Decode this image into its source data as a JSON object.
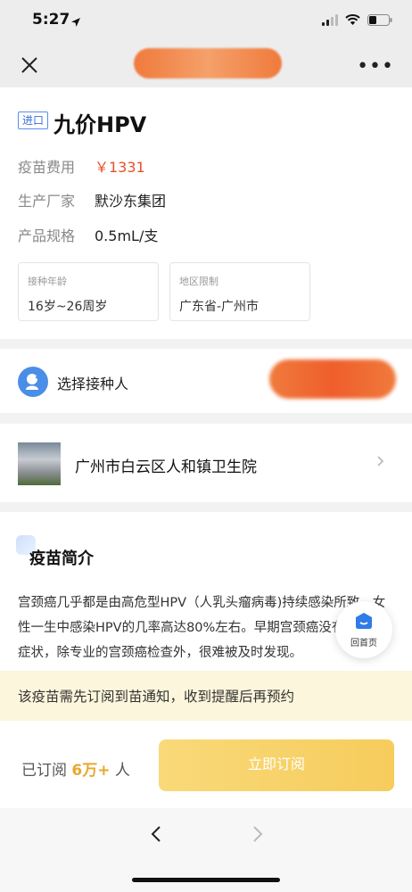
{
  "status_bar": {
    "time": "5:27"
  },
  "vaccine": {
    "import_tag": "进口",
    "name": "九价HPV",
    "fee_label": "疫苗费用",
    "fee_value": "￥1331",
    "maker_label": "生产厂家",
    "maker_value": "默沙东集团",
    "spec_label": "产品规格",
    "spec_value": "0.5mL/支",
    "age_label": "接种年龄",
    "age_value": "16岁~26周岁",
    "region_label": "地区限制",
    "region_value": "广东省-广州市"
  },
  "recipient": {
    "label": "选择接种人"
  },
  "hospital": {
    "name": "广州市白云区人和镇卫生院"
  },
  "intro": {
    "title": "疫苗简介",
    "text": "宫颈癌几乎都是由高危型HPV（人乳头瘤病毒)持续感染所致，女性一生中感染HPV的几率高达80%左右。早期宫颈癌没有明显的症状，除专业的宫颈癌检查外，很难被及时发现。"
  },
  "home_button": {
    "label": "回首页"
  },
  "notice": {
    "text": "该疫苗需先订阅到苗通知，收到提醒后再预约"
  },
  "action": {
    "subscribed_prefix": "已订阅",
    "subscribed_count": "6万+",
    "subscribed_suffix": "人",
    "subscribe_button": "立即订阅"
  },
  "colors": {
    "accent_blue": "#4a8ee8",
    "price_red": "#e5512b",
    "button_yellow": "#f6cc5c",
    "notice_bg": "#fbf6dc"
  },
  "icons": [
    "location-arrow-icon",
    "signal-icon",
    "wifi-icon",
    "battery-icon",
    "close-icon",
    "more-icon",
    "person-icon",
    "chevron-right-icon",
    "home-icon",
    "back-icon",
    "forward-icon"
  ]
}
